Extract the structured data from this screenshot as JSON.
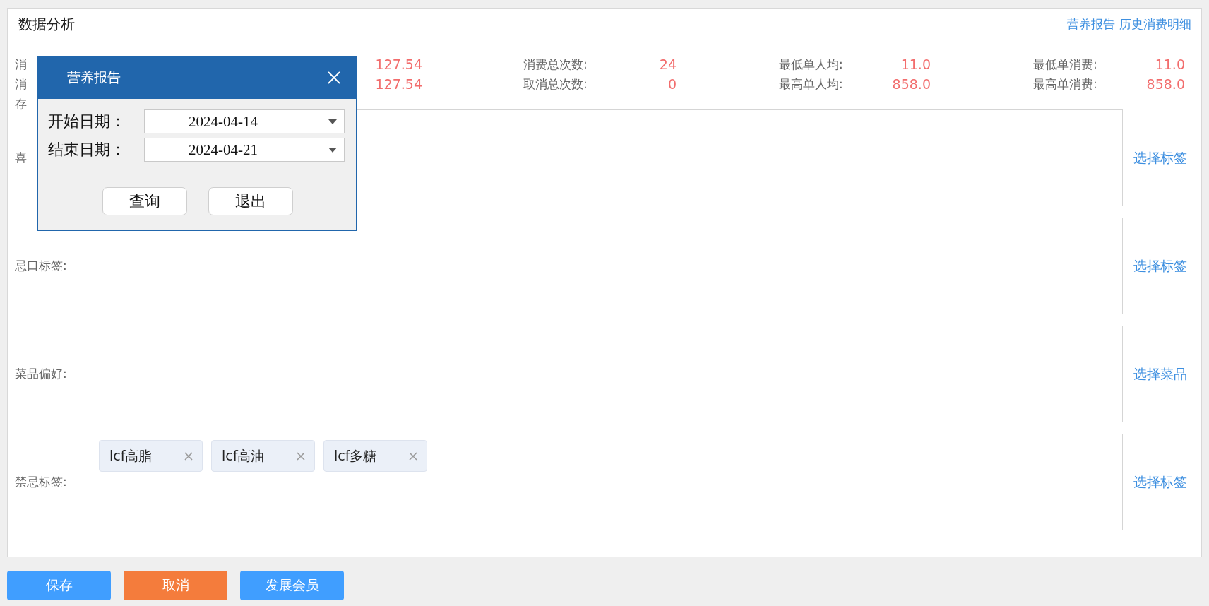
{
  "panel": {
    "title": "数据分析",
    "links": [
      "营养报告",
      "历史消费明细"
    ]
  },
  "stats": [
    [
      {
        "label": "消",
        "value": "127.54"
      },
      {
        "label": "消费总次数:",
        "value": "24"
      },
      {
        "label": "最低单人均:",
        "value": "11.0"
      },
      {
        "label": "最低单消费:",
        "value": "11.0"
      }
    ],
    [
      {
        "label": "消",
        "value": "127.54"
      },
      {
        "label": "取消总次数:",
        "value": "0"
      },
      {
        "label": "最高单人均:",
        "value": "858.0"
      },
      {
        "label": "最高单消费:",
        "value": "858.0"
      }
    ],
    [
      {
        "label": "存"
      }
    ]
  ],
  "tag_rows": [
    {
      "label": "喜",
      "action": "选择标签",
      "tags": []
    },
    {
      "label": "忌口标签:",
      "action": "选择标签",
      "tags": []
    },
    {
      "label": "菜品偏好:",
      "action": "选择菜品",
      "tags": []
    },
    {
      "label": "禁忌标签:",
      "action": "选择标签",
      "tags": [
        "lcf高脂",
        "lcf高油",
        "lcf多糖"
      ]
    }
  ],
  "buttons": [
    {
      "label": "保存",
      "kind": "primary"
    },
    {
      "label": "取消",
      "kind": "warning"
    },
    {
      "label": "发展会员",
      "kind": "primary"
    }
  ],
  "dialog": {
    "title": "营养报告",
    "fields": [
      {
        "label": "开始日期：",
        "value": "2024-04-14"
      },
      {
        "label": "结束日期：",
        "value": "2024-04-21"
      }
    ],
    "buttons": [
      "查询",
      "退出"
    ]
  }
}
